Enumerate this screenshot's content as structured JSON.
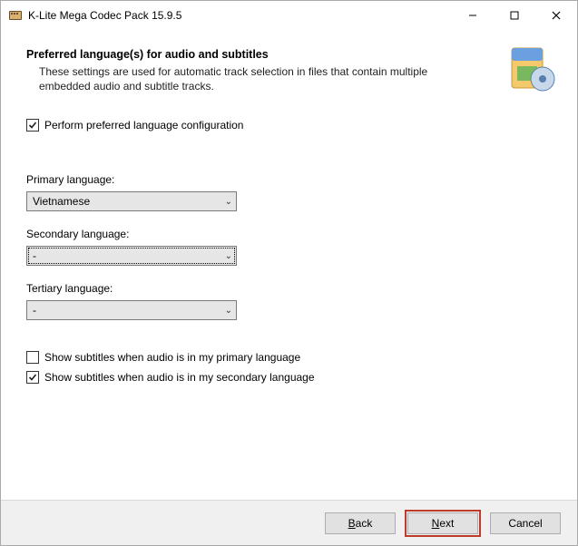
{
  "titlebar": {
    "title": "K-Lite Mega Codec Pack 15.9.5"
  },
  "header": {
    "heading": "Preferred language(s) for audio and subtitles",
    "subtext": "These settings are used for automatic track selection in files that contain multiple embedded audio and subtitle tracks."
  },
  "checkboxes": {
    "perform_config": {
      "label": "Perform preferred language configuration",
      "checked": true
    },
    "show_sub_primary": {
      "label": "Show subtitles when audio is in my primary language",
      "checked": false
    },
    "show_sub_secondary": {
      "label": "Show subtitles when audio is in my secondary language",
      "checked": true
    }
  },
  "fields": {
    "primary": {
      "label": "Primary language:",
      "value": "Vietnamese"
    },
    "secondary": {
      "label": "Secondary language:",
      "value": "-"
    },
    "tertiary": {
      "label": "Tertiary language:",
      "value": "-"
    }
  },
  "footer": {
    "back": "Back",
    "next": "Next",
    "cancel": "Cancel"
  }
}
